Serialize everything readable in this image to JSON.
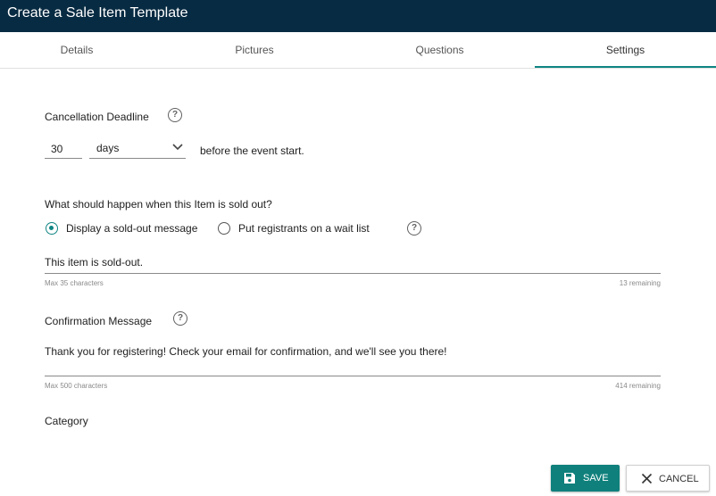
{
  "window": {
    "title": "Create a Sale Item Template"
  },
  "tabs": [
    {
      "label": "Details"
    },
    {
      "label": "Pictures"
    },
    {
      "label": "Questions"
    },
    {
      "label": "Settings",
      "active": true
    }
  ],
  "cancellation": {
    "label": "Cancellation Deadline",
    "help_icon": "question-circle-icon",
    "amount": "30",
    "unit": "days",
    "suffix": "before the event start."
  },
  "sold_out": {
    "question": "What should happen when this Item is sold out?",
    "options": [
      {
        "label": "Display a sold-out message",
        "selected": true
      },
      {
        "label": "Put registrants on a wait list",
        "selected": false
      }
    ],
    "help_icon": "question-circle-icon",
    "message": "This item is sold-out.",
    "hint": "Max 35 characters",
    "remaining": "13 remaining"
  },
  "confirmation": {
    "label": "Confirmation Message",
    "help_icon": "question-circle-icon",
    "message": "Thank you for registering! Check your email for confirmation, and we'll see you there!",
    "hint": "Max 500 characters",
    "remaining": "414 remaining"
  },
  "category": {
    "label": "Category"
  },
  "actions": {
    "save_label": "SAVE",
    "save_icon": "floppy-disk-icon",
    "cancel_label": "CANCEL",
    "cancel_icon": "close-icon"
  },
  "colors": {
    "header_bg": "#072b42",
    "accent": "#0f8583"
  }
}
